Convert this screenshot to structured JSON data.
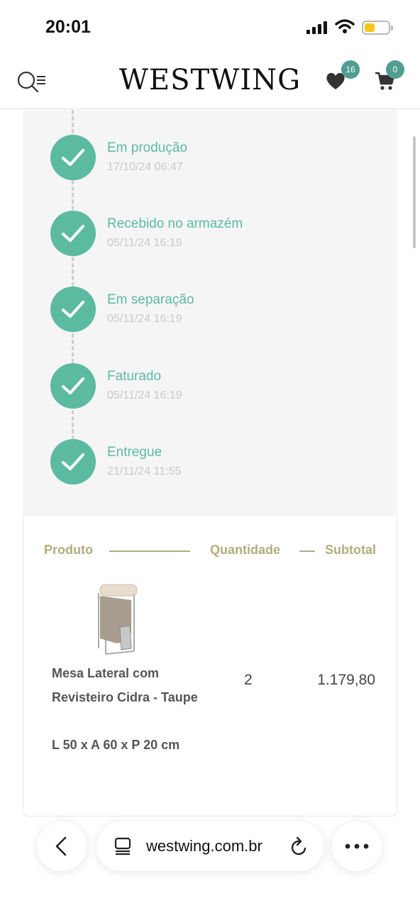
{
  "status_bar": {
    "time": "20:01"
  },
  "header": {
    "logo": "WESTWING",
    "favorites_count": "16",
    "cart_count": "0"
  },
  "timeline": {
    "steps": [
      {
        "title": "Em produção",
        "date": "17/10/24 06:47"
      },
      {
        "title": "Recebido no armazém",
        "date": "05/11/24 16:19"
      },
      {
        "title": "Em separação",
        "date": "05/11/24 16:19"
      },
      {
        "title": "Faturado",
        "date": "05/11/24 16:19"
      },
      {
        "title": "Entregue",
        "date": "21/11/24 11:55"
      }
    ]
  },
  "products": {
    "columns": {
      "product": "Produto",
      "quantity": "Quantidade",
      "subtotal": "Subtotal"
    },
    "items": [
      {
        "name": "Mesa Lateral com Revisteiro Cidra - Taupe",
        "dimensions": "L 50 x A 60 x P 20 cm",
        "quantity": "2",
        "subtotal": "1.179,80"
      }
    ]
  },
  "browser": {
    "url": "westwing.com.br"
  },
  "colors": {
    "accent": "#5cbaa1",
    "gold": "#b3ad7c",
    "badge": "#4f9e90"
  },
  "icons": [
    "search-menu-icon",
    "heart-icon",
    "cart-icon",
    "check-icon",
    "back-icon",
    "tabs-icon",
    "reload-icon",
    "more-icon"
  ]
}
